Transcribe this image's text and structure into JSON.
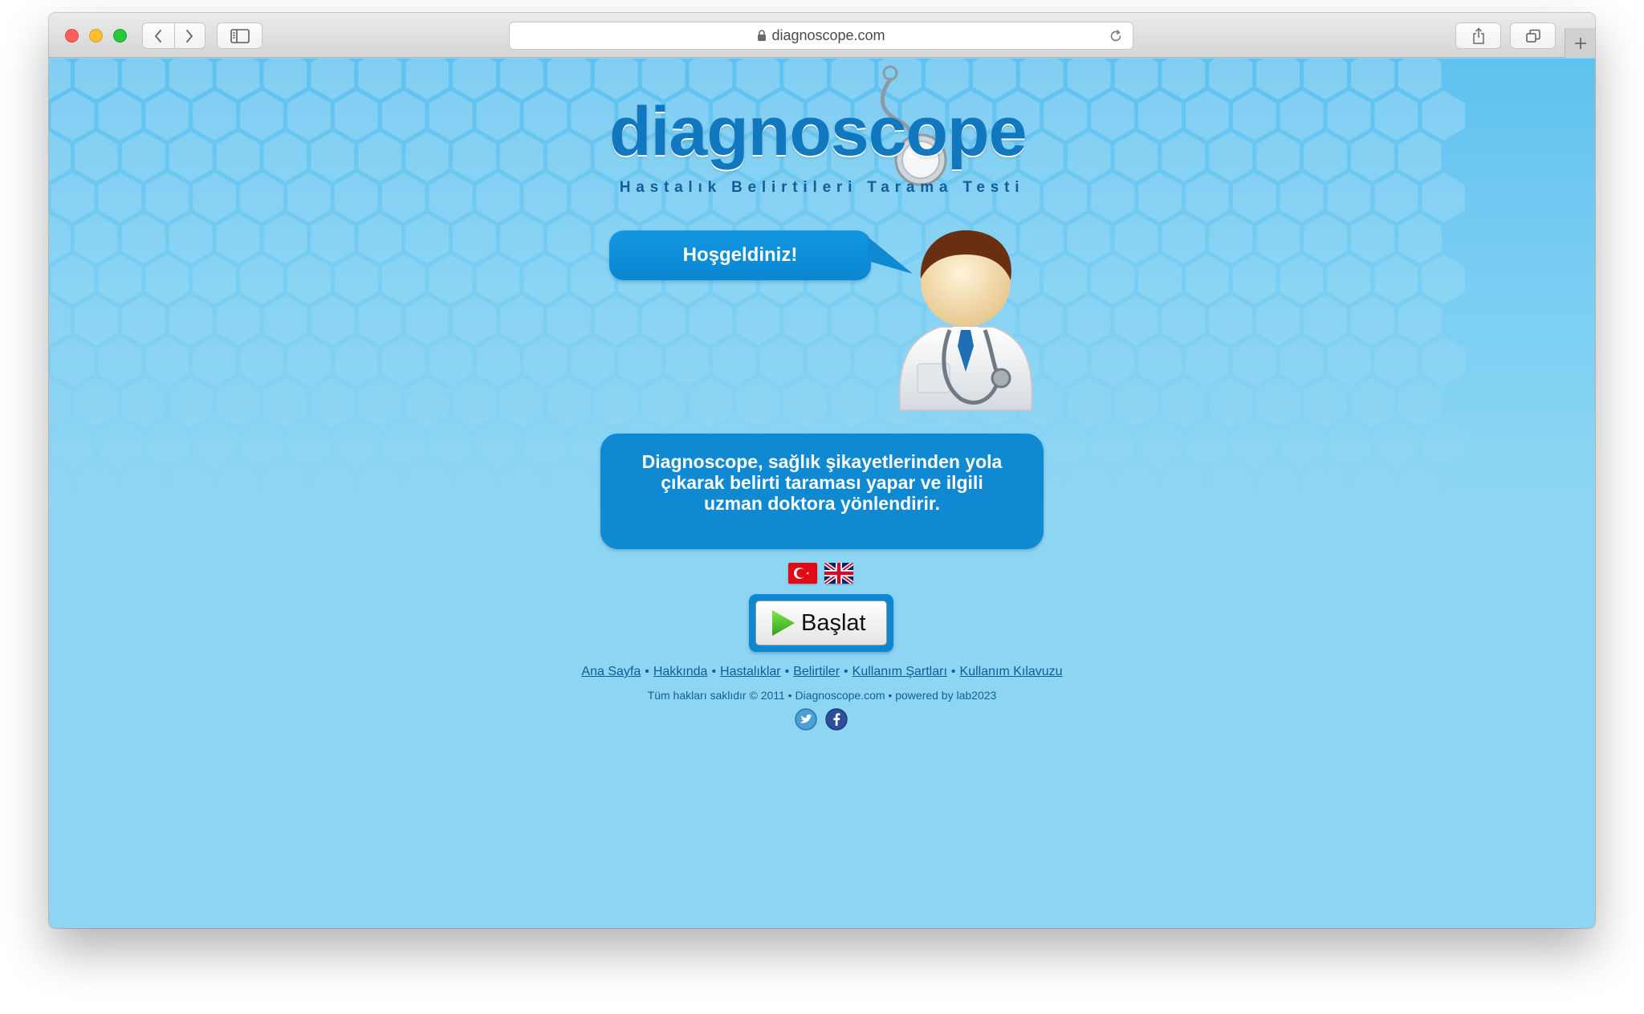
{
  "browser": {
    "url": "diagnoscope.com",
    "icons": {
      "back": "chevron-left-icon",
      "forward": "chevron-right-icon",
      "sidebar": "sidebar-icon",
      "lock": "lock-icon",
      "reload": "reload-icon",
      "share": "share-icon",
      "tabs": "tabs-icon",
      "new_tab": "plus-icon"
    }
  },
  "site": {
    "logo_text": "diagnoscope",
    "tagline": "Hastalık Belirtileri Tarama Testi",
    "welcome": "Hoşgeldiniz!",
    "description": "Diagnoscope, sağlık şikayetlerinden yola çıkarak belirti taraması yapar ve ilgili uzman doktora yönlendirir.",
    "languages": [
      "tr-flag-icon",
      "uk-flag-icon"
    ],
    "start_button": "Başlat",
    "footer_links": [
      "Ana Sayfa",
      "Hakkında",
      "Hastalıklar",
      "Belirtiler",
      "Kullanım Şartları",
      "Kullanım Kılavuzu"
    ],
    "copyright": "Tüm hakları saklıdır © 2011 • Diagnoscope.com • powered by lab2023",
    "social": [
      "twitter-icon",
      "facebook-icon"
    ]
  },
  "colors": {
    "page_background": "#8dd6f3",
    "brand_blue": "#0e89d2",
    "logo_blue": "#1177be",
    "link_blue": "#0d5c99"
  }
}
